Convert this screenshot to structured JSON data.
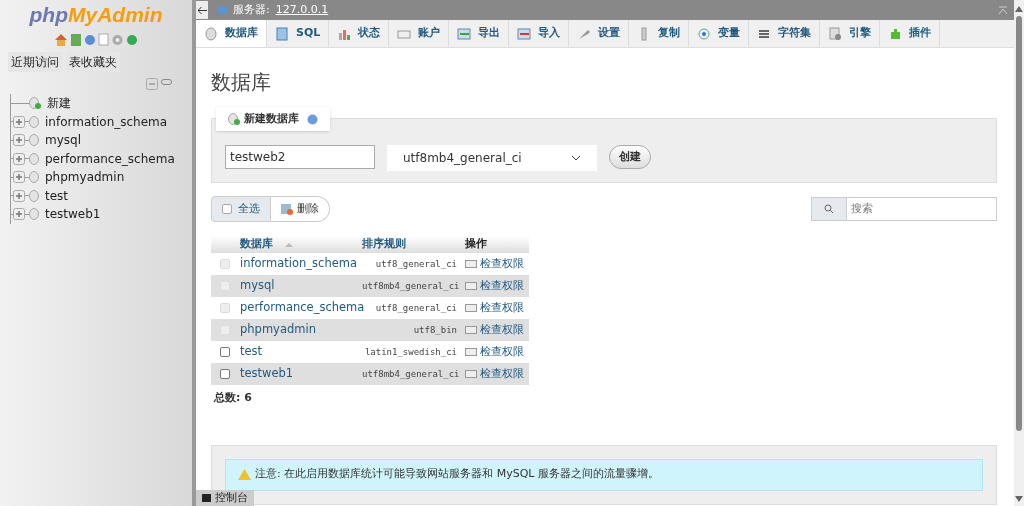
{
  "sidebar": {
    "logo": {
      "first": "php",
      "second": "MyAdmin"
    },
    "tabs": [
      {
        "label": "近期访问"
      },
      {
        "label": "表收藏夹"
      }
    ],
    "tree": [
      {
        "label": "新建",
        "kind": "new"
      },
      {
        "label": "information_schema",
        "kind": "db"
      },
      {
        "label": "mysql",
        "kind": "db"
      },
      {
        "label": "performance_schema",
        "kind": "db"
      },
      {
        "label": "phpmyadmin",
        "kind": "db"
      },
      {
        "label": "test",
        "kind": "db"
      },
      {
        "label": "testweb1",
        "kind": "db"
      }
    ]
  },
  "breadcrumb": {
    "label": "服务器:",
    "server": "127.0.0.1"
  },
  "tabs": [
    {
      "label": "数据库",
      "selected": true
    },
    {
      "label": "SQL",
      "selected": false
    },
    {
      "label": "状态",
      "selected": false
    },
    {
      "label": "账户",
      "selected": false
    },
    {
      "label": "导出",
      "selected": false
    },
    {
      "label": "导入",
      "selected": false
    },
    {
      "label": "设置",
      "selected": false
    },
    {
      "label": "复制",
      "selected": false
    },
    {
      "label": "变量",
      "selected": false
    },
    {
      "label": "字符集",
      "selected": false
    },
    {
      "label": "引擎",
      "selected": false
    },
    {
      "label": "插件",
      "selected": false
    }
  ],
  "page_title": "数据库",
  "create": {
    "legend": "新建数据库",
    "name_value": "testweb2",
    "collation": "utf8mb4_general_ci",
    "button": "创建"
  },
  "actions": {
    "select_all": "全选",
    "delete": "删除",
    "search_placeholder": "搜索"
  },
  "table": {
    "columns": [
      "数据库",
      "排序规则",
      "操作"
    ],
    "rows": [
      {
        "name": "information_schema",
        "collation": "utf8_general_ci",
        "action": "检查权限",
        "disabled": true
      },
      {
        "name": "mysql",
        "collation": "utf8mb4_general_ci",
        "action": "检查权限",
        "disabled": true
      },
      {
        "name": "performance_schema",
        "collation": "utf8_general_ci",
        "action": "检查权限",
        "disabled": true
      },
      {
        "name": "phpmyadmin",
        "collation": "utf8_bin",
        "action": "检查权限",
        "disabled": true
      },
      {
        "name": "test",
        "collation": "latin1_swedish_ci",
        "action": "检查权限",
        "disabled": false
      },
      {
        "name": "testweb1",
        "collation": "utf8mb4_general_ci",
        "action": "检查权限",
        "disabled": false
      }
    ],
    "total": "总数: 6"
  },
  "notice": "注意: 在此启用数据库统计可能导致网站服务器和 MySQL 服务器之间的流量骤增。",
  "console": "控制台"
}
